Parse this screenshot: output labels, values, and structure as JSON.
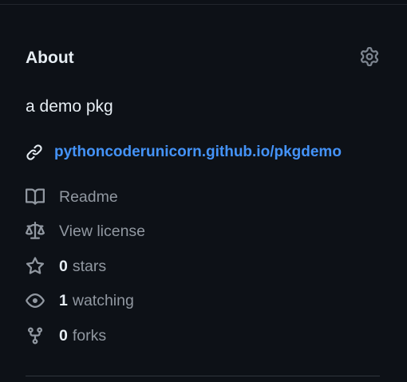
{
  "about": {
    "title": "About",
    "settings_icon": "gear-icon",
    "description": "a demo pkg",
    "homepage": {
      "icon": "link-icon",
      "text": "pythoncoderunicorn.github.io/pkgdemo"
    },
    "meta": {
      "readme": {
        "icon": "book-icon",
        "label": "Readme"
      },
      "license": {
        "icon": "law-icon",
        "label": "View license"
      },
      "stars": {
        "icon": "star-icon",
        "count": "0",
        "label": "stars"
      },
      "watching": {
        "icon": "eye-icon",
        "count": "1",
        "label": "watching"
      },
      "forks": {
        "icon": "repo-forked-icon",
        "count": "0",
        "label": "forks"
      }
    }
  },
  "colors": {
    "background": "#0d1117",
    "text_primary": "#e6edf3",
    "text_muted": "#9198a1",
    "link": "#4493f8",
    "border": "#30363d"
  }
}
